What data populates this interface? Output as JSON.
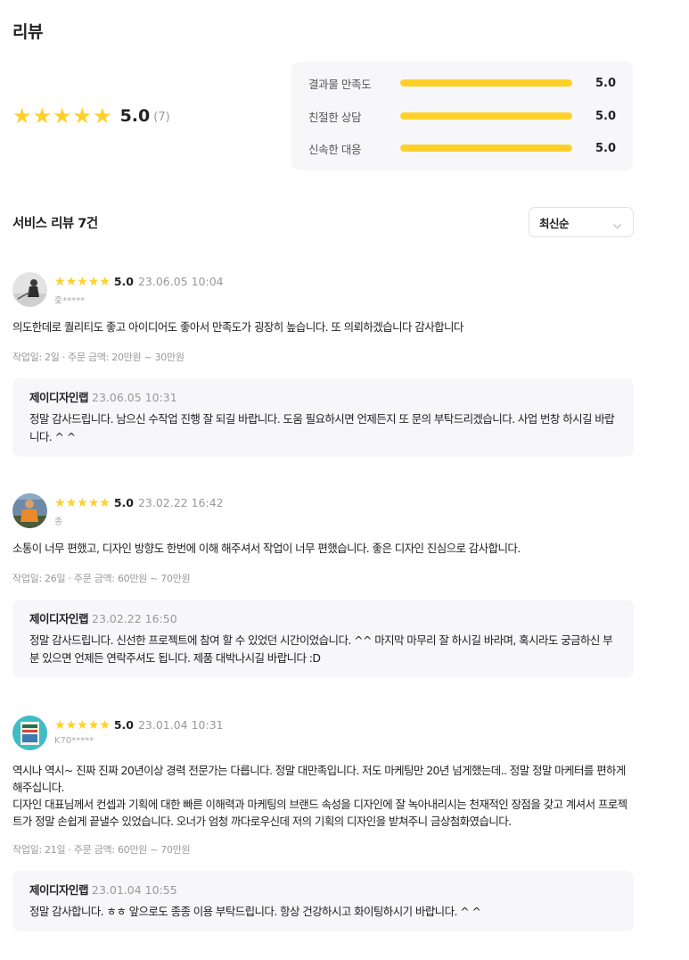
{
  "page": {
    "title": "리뷰"
  },
  "summary": {
    "stars": 5,
    "average": "5.0",
    "count": "7",
    "star_color": "#ffd028",
    "scores": [
      {
        "label": "결과물 만족도",
        "value": "5.0",
        "fraction": 1.0
      },
      {
        "label": "친절한 상담",
        "value": "5.0",
        "fraction": 1.0
      },
      {
        "label": "신속한 대응",
        "value": "5.0",
        "fraction": 1.0
      }
    ]
  },
  "service_reviews": {
    "title": "서비스 리뷰 7건",
    "sort": {
      "selected": "최신순",
      "icon": "chevron-down-icon"
    }
  },
  "reviews": [
    {
      "stars": 5,
      "score": "5.0",
      "date": "23.06.05 10:04",
      "user": "줒*****",
      "text": "의도한데로 퀄리티도 좋고 아이디어도 좋아서 만족도가 굉장히 높습니다. 또 의뢰하겠습니다 감사합니다",
      "meta": "작업일: 2일 · 주문 금액: 20만원 ~ 30만원",
      "reply": {
        "name": "제이디자인랩",
        "date": "23.06.05 10:31",
        "text": "정말 감사드립니다. 남으신 수작업 진행 잘 되길 바랍니다. 도움 필요하시면 언제든지 또 문의 부탁드리겠습니다. 사업 번창 하시길 바랍니다. ^ ^"
      }
    },
    {
      "stars": 5,
      "score": "5.0",
      "date": "23.02.22 16:42",
      "user": "종",
      "text": "소통이 너무 편했고, 디자인 방향도 한번에 이해 해주셔서 작업이 너무 편했습니다. 좋은 디자인 진심으로 감사합니다.",
      "meta": "작업일: 26일 · 주문 금액: 60만원 ~ 70만원",
      "reply": {
        "name": "제이디자인랩",
        "date": "23.02.22 16:50",
        "text": "정말 감사드립니다. 신선한 프로젝트에 참여 할 수 있었던 시간이었습니다. ^^ 마지막 마무리 잘 하시길 바라며, 혹시라도 궁금하신 부분 있으면 언제든 연락주셔도 됩니다. 제품 대박나시길 바랍니다 :D"
      }
    },
    {
      "stars": 5,
      "score": "5.0",
      "date": "23.01.04 10:31",
      "user": "K70*****",
      "text": "역시나 역시~ 진짜 진짜 20년이상 경력 전문가는 다릅니다. 정말 대만족입니다. 저도 마케팅만 20년 넘게했는데.. 정말 정말 마케터를 편하게 해주십니다.\n디자인 대표님께서 컨셉과 기획에 대한 빠른 이해력과 마케팅의 브랜드 속성을 디자인에 잘 녹아내리시는 천재적인 장점을 갖고 계셔서 프로젝트가 정말 손쉽게 끝낼수 있었습니다. 오너가 엄청 까다로우신데 저의 기획의 디자인을 받쳐주니 금상첨화였습니다.",
      "meta": "작업일: 21일 · 주문 금액: 60만원 ~ 70만원",
      "reply": {
        "name": "제이디자인랩",
        "date": "23.01.04 10:55",
        "text": "정말 감사합니다. ㅎㅎ 앞으로도 종종 이용 부탁드립니다. 항상 건강하시고 화이팅하시기 바랍니다. ^ ^"
      }
    }
  ]
}
